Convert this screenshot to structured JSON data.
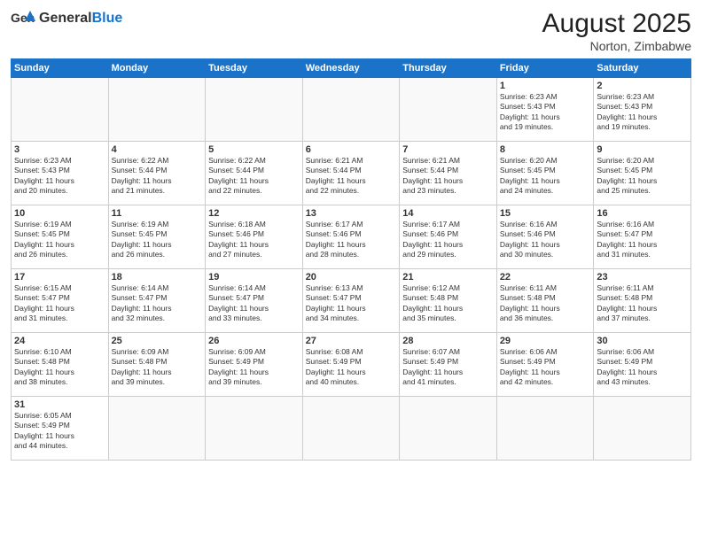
{
  "header": {
    "logo_general": "General",
    "logo_blue": "Blue",
    "month_title": "August 2025",
    "subtitle": "Norton, Zimbabwe"
  },
  "weekdays": [
    "Sunday",
    "Monday",
    "Tuesday",
    "Wednesday",
    "Thursday",
    "Friday",
    "Saturday"
  ],
  "weeks": [
    [
      {
        "day": "",
        "info": ""
      },
      {
        "day": "",
        "info": ""
      },
      {
        "day": "",
        "info": ""
      },
      {
        "day": "",
        "info": ""
      },
      {
        "day": "",
        "info": ""
      },
      {
        "day": "1",
        "info": "Sunrise: 6:23 AM\nSunset: 5:43 PM\nDaylight: 11 hours\nand 19 minutes."
      },
      {
        "day": "2",
        "info": "Sunrise: 6:23 AM\nSunset: 5:43 PM\nDaylight: 11 hours\nand 19 minutes."
      }
    ],
    [
      {
        "day": "3",
        "info": "Sunrise: 6:23 AM\nSunset: 5:43 PM\nDaylight: 11 hours\nand 20 minutes."
      },
      {
        "day": "4",
        "info": "Sunrise: 6:22 AM\nSunset: 5:44 PM\nDaylight: 11 hours\nand 21 minutes."
      },
      {
        "day": "5",
        "info": "Sunrise: 6:22 AM\nSunset: 5:44 PM\nDaylight: 11 hours\nand 22 minutes."
      },
      {
        "day": "6",
        "info": "Sunrise: 6:21 AM\nSunset: 5:44 PM\nDaylight: 11 hours\nand 22 minutes."
      },
      {
        "day": "7",
        "info": "Sunrise: 6:21 AM\nSunset: 5:44 PM\nDaylight: 11 hours\nand 23 minutes."
      },
      {
        "day": "8",
        "info": "Sunrise: 6:20 AM\nSunset: 5:45 PM\nDaylight: 11 hours\nand 24 minutes."
      },
      {
        "day": "9",
        "info": "Sunrise: 6:20 AM\nSunset: 5:45 PM\nDaylight: 11 hours\nand 25 minutes."
      }
    ],
    [
      {
        "day": "10",
        "info": "Sunrise: 6:19 AM\nSunset: 5:45 PM\nDaylight: 11 hours\nand 26 minutes."
      },
      {
        "day": "11",
        "info": "Sunrise: 6:19 AM\nSunset: 5:45 PM\nDaylight: 11 hours\nand 26 minutes."
      },
      {
        "day": "12",
        "info": "Sunrise: 6:18 AM\nSunset: 5:46 PM\nDaylight: 11 hours\nand 27 minutes."
      },
      {
        "day": "13",
        "info": "Sunrise: 6:17 AM\nSunset: 5:46 PM\nDaylight: 11 hours\nand 28 minutes."
      },
      {
        "day": "14",
        "info": "Sunrise: 6:17 AM\nSunset: 5:46 PM\nDaylight: 11 hours\nand 29 minutes."
      },
      {
        "day": "15",
        "info": "Sunrise: 6:16 AM\nSunset: 5:46 PM\nDaylight: 11 hours\nand 30 minutes."
      },
      {
        "day": "16",
        "info": "Sunrise: 6:16 AM\nSunset: 5:47 PM\nDaylight: 11 hours\nand 31 minutes."
      }
    ],
    [
      {
        "day": "17",
        "info": "Sunrise: 6:15 AM\nSunset: 5:47 PM\nDaylight: 11 hours\nand 31 minutes."
      },
      {
        "day": "18",
        "info": "Sunrise: 6:14 AM\nSunset: 5:47 PM\nDaylight: 11 hours\nand 32 minutes."
      },
      {
        "day": "19",
        "info": "Sunrise: 6:14 AM\nSunset: 5:47 PM\nDaylight: 11 hours\nand 33 minutes."
      },
      {
        "day": "20",
        "info": "Sunrise: 6:13 AM\nSunset: 5:47 PM\nDaylight: 11 hours\nand 34 minutes."
      },
      {
        "day": "21",
        "info": "Sunrise: 6:12 AM\nSunset: 5:48 PM\nDaylight: 11 hours\nand 35 minutes."
      },
      {
        "day": "22",
        "info": "Sunrise: 6:11 AM\nSunset: 5:48 PM\nDaylight: 11 hours\nand 36 minutes."
      },
      {
        "day": "23",
        "info": "Sunrise: 6:11 AM\nSunset: 5:48 PM\nDaylight: 11 hours\nand 37 minutes."
      }
    ],
    [
      {
        "day": "24",
        "info": "Sunrise: 6:10 AM\nSunset: 5:48 PM\nDaylight: 11 hours\nand 38 minutes."
      },
      {
        "day": "25",
        "info": "Sunrise: 6:09 AM\nSunset: 5:48 PM\nDaylight: 11 hours\nand 39 minutes."
      },
      {
        "day": "26",
        "info": "Sunrise: 6:09 AM\nSunset: 5:49 PM\nDaylight: 11 hours\nand 39 minutes."
      },
      {
        "day": "27",
        "info": "Sunrise: 6:08 AM\nSunset: 5:49 PM\nDaylight: 11 hours\nand 40 minutes."
      },
      {
        "day": "28",
        "info": "Sunrise: 6:07 AM\nSunset: 5:49 PM\nDaylight: 11 hours\nand 41 minutes."
      },
      {
        "day": "29",
        "info": "Sunrise: 6:06 AM\nSunset: 5:49 PM\nDaylight: 11 hours\nand 42 minutes."
      },
      {
        "day": "30",
        "info": "Sunrise: 6:06 AM\nSunset: 5:49 PM\nDaylight: 11 hours\nand 43 minutes."
      }
    ],
    [
      {
        "day": "31",
        "info": "Sunrise: 6:05 AM\nSunset: 5:49 PM\nDaylight: 11 hours\nand 44 minutes."
      },
      {
        "day": "",
        "info": ""
      },
      {
        "day": "",
        "info": ""
      },
      {
        "day": "",
        "info": ""
      },
      {
        "day": "",
        "info": ""
      },
      {
        "day": "",
        "info": ""
      },
      {
        "day": "",
        "info": ""
      }
    ]
  ]
}
